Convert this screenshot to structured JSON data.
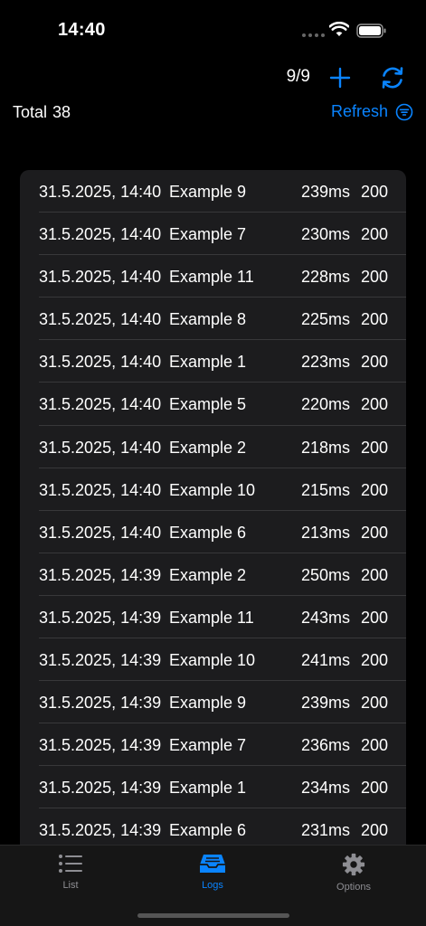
{
  "status": {
    "time": "14:40"
  },
  "nav": {
    "page_count": "9/9"
  },
  "summary": {
    "total_label": "Total",
    "total_value": "38",
    "refresh_label": "Refresh"
  },
  "logs": [
    {
      "date": "31.5.2025, 14:40",
      "name": "Example 9",
      "ms": "239ms",
      "code": "200"
    },
    {
      "date": "31.5.2025, 14:40",
      "name": "Example 7",
      "ms": "230ms",
      "code": "200"
    },
    {
      "date": "31.5.2025, 14:40",
      "name": "Example 11",
      "ms": "228ms",
      "code": "200"
    },
    {
      "date": "31.5.2025, 14:40",
      "name": "Example 8",
      "ms": "225ms",
      "code": "200"
    },
    {
      "date": "31.5.2025, 14:40",
      "name": "Example 1",
      "ms": "223ms",
      "code": "200"
    },
    {
      "date": "31.5.2025, 14:40",
      "name": "Example 5",
      "ms": "220ms",
      "code": "200"
    },
    {
      "date": "31.5.2025, 14:40",
      "name": "Example 2",
      "ms": "218ms",
      "code": "200"
    },
    {
      "date": "31.5.2025, 14:40",
      "name": "Example 10",
      "ms": "215ms",
      "code": "200"
    },
    {
      "date": "31.5.2025, 14:40",
      "name": "Example 6",
      "ms": "213ms",
      "code": "200"
    },
    {
      "date": "31.5.2025, 14:39",
      "name": "Example 2",
      "ms": "250ms",
      "code": "200"
    },
    {
      "date": "31.5.2025, 14:39",
      "name": "Example 11",
      "ms": "243ms",
      "code": "200"
    },
    {
      "date": "31.5.2025, 14:39",
      "name": "Example 10",
      "ms": "241ms",
      "code": "200"
    },
    {
      "date": "31.5.2025, 14:39",
      "name": "Example 9",
      "ms": "239ms",
      "code": "200"
    },
    {
      "date": "31.5.2025, 14:39",
      "name": "Example 7",
      "ms": "236ms",
      "code": "200"
    },
    {
      "date": "31.5.2025, 14:39",
      "name": "Example 1",
      "ms": "234ms",
      "code": "200"
    },
    {
      "date": "31.5.2025, 14:39",
      "name": "Example 6",
      "ms": "231ms",
      "code": "200"
    }
  ],
  "tabs": [
    {
      "label": "List",
      "icon": "list-icon",
      "active": false
    },
    {
      "label": "Logs",
      "icon": "tray-icon",
      "active": true
    },
    {
      "label": "Options",
      "icon": "gear-icon",
      "active": false
    }
  ],
  "colors": {
    "accent": "#0a84ff",
    "background": "#000000",
    "card": "#1c1c1e"
  }
}
